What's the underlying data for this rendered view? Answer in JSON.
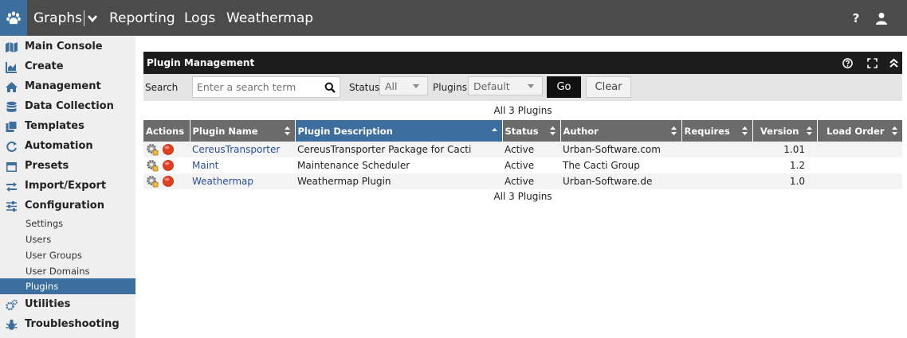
{
  "topbar": {
    "nav": [
      "Graphs",
      "Reporting",
      "Logs",
      "Weathermap"
    ],
    "help_label": "?"
  },
  "sidebar": {
    "items": [
      {
        "label": "Main Console",
        "icon": "map-icon"
      },
      {
        "label": "Create",
        "icon": "chart-icon"
      },
      {
        "label": "Management",
        "icon": "home-icon"
      },
      {
        "label": "Data Collection",
        "icon": "database-icon"
      },
      {
        "label": "Templates",
        "icon": "copy-icon"
      },
      {
        "label": "Automation",
        "icon": "automation-icon"
      },
      {
        "label": "Presets",
        "icon": "calendar-icon"
      },
      {
        "label": "Import/Export",
        "icon": "exchange-icon"
      },
      {
        "label": "Configuration",
        "icon": "sliders-icon"
      }
    ],
    "sub_items": [
      "Settings",
      "Users",
      "User Groups",
      "User Domains",
      "Plugins"
    ],
    "active_sub": "Plugins",
    "bottom_items": [
      {
        "label": "Utilities",
        "icon": "cogs-icon"
      },
      {
        "label": "Troubleshooting",
        "icon": "bug-icon"
      }
    ]
  },
  "panel": {
    "title": "Plugin Management"
  },
  "filter": {
    "search_label": "Search",
    "search_placeholder": "Enter a search term",
    "status_label": "Status",
    "status_value": "All",
    "plugins_label": "Plugins",
    "plugins_value": "Default",
    "go_label": "Go",
    "clear_label": "Clear"
  },
  "count_text": "All 3 Plugins",
  "table": {
    "columns": [
      "Actions",
      "Plugin Name",
      "Plugin Description",
      "Status",
      "Author",
      "Requires",
      "Version",
      "Load Order"
    ],
    "sorted_column": "Plugin Description",
    "rows": [
      {
        "name": "CereusTransporter",
        "description": "CereusTransporter Package for Cacti",
        "status": "Active",
        "author": "Urban-Software.com",
        "requires": "",
        "version": "1.01",
        "load_order": ""
      },
      {
        "name": "Maint",
        "description": "Maintenance Scheduler",
        "status": "Active",
        "author": "The Cacti Group",
        "requires": "",
        "version": "1.2",
        "load_order": ""
      },
      {
        "name": "Weathermap",
        "description": "Weathermap Plugin",
        "status": "Active",
        "author": "Urban-Software.de",
        "requires": "",
        "version": "1.0",
        "load_order": ""
      }
    ]
  },
  "colors": {
    "accent": "#3d6f9e",
    "topbar": "#4b4b4b",
    "header_dark": "#1c1c1c",
    "table_header": "#6b6b6b",
    "link": "#2c4f9a",
    "disable_red": "#e53b1f"
  }
}
